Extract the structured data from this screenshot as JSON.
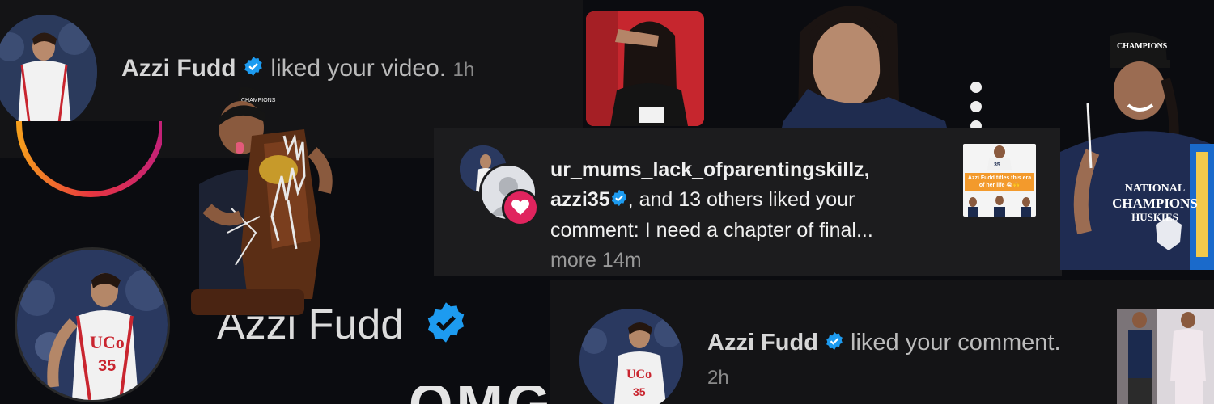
{
  "notif_top": {
    "username": "Azzi Fudd",
    "action": "liked your video.",
    "time": "1h"
  },
  "profile": {
    "name": "Azzi Fudd",
    "partial_caption": "OMG"
  },
  "notif_center": {
    "user1": "ur_mums_lack_ofparentingskillz,",
    "user2": "azzi35",
    "rest": ", and 13 others liked your",
    "comment": "comment: I need a chapter of final...",
    "more": "more",
    "time": "14m",
    "thumb_caption": "Azzi Fudd titles this era of her life 😭🙌"
  },
  "notif_bottom": {
    "username": "Azzi Fudd",
    "action": "liked your comment.",
    "time": "2h"
  },
  "jersey": {
    "team": "UConn",
    "number": "35"
  },
  "shirt": {
    "line1": "NATIONAL",
    "line2": "CHAMPIONS",
    "line3": "HUSKIES",
    "hat": "CHAMPIONS"
  },
  "colors": {
    "verified_blue": "#1d9bf0",
    "like_red": "#e0245e",
    "navy": "#1b2a4e"
  }
}
